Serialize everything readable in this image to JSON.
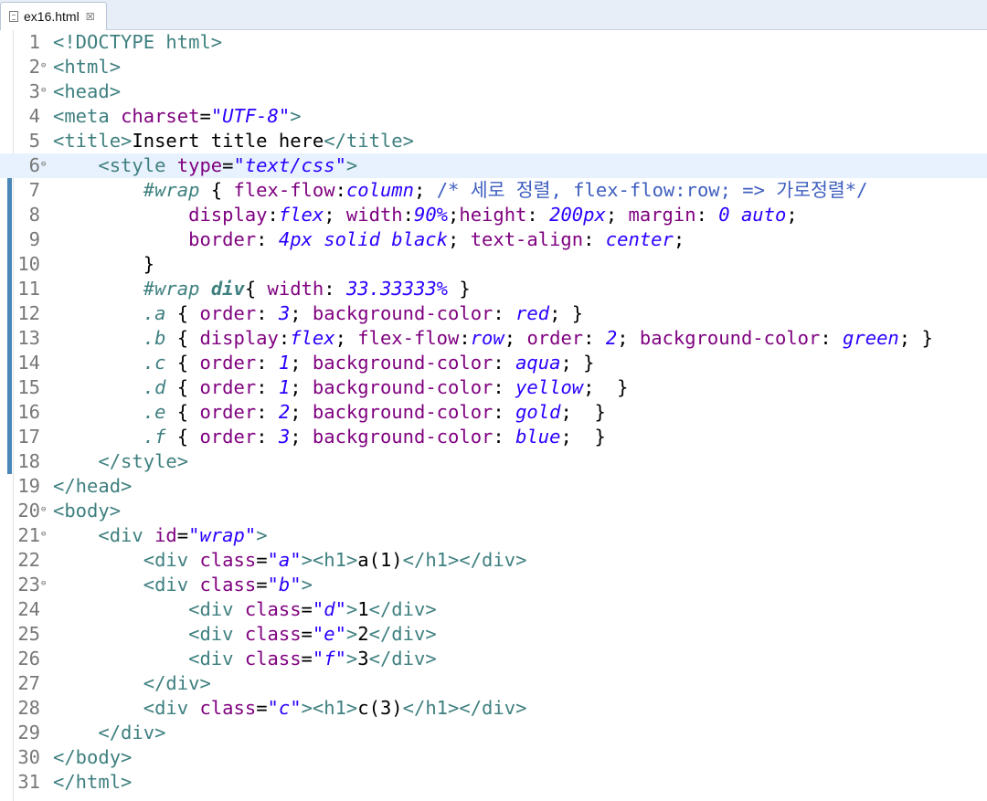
{
  "tab": {
    "title": "ex16.html",
    "close_glyph": "☒"
  },
  "colors": {
    "tag": "#3f7f7f",
    "attribute": "#7f007f",
    "value": "#2a00ff",
    "comment": "#3f5fbf",
    "current_line": "#e8f2fe",
    "change_bar": "#4a86b8"
  },
  "current_line": 6,
  "lines": [
    {
      "n": "1",
      "fold": false,
      "tokens": [
        {
          "t": "<!DOCTYPE html>",
          "c": "tag"
        }
      ]
    },
    {
      "n": "2",
      "fold": true,
      "tokens": [
        {
          "t": "<html>",
          "c": "tag"
        }
      ]
    },
    {
      "n": "3",
      "fold": true,
      "tokens": [
        {
          "t": "<head>",
          "c": "tag"
        }
      ]
    },
    {
      "n": "4",
      "fold": false,
      "tokens": [
        {
          "t": "<meta ",
          "c": "tag"
        },
        {
          "t": "charset",
          "c": "attr"
        },
        {
          "t": "=",
          "c": "pun"
        },
        {
          "t": "\"UTF-8\"",
          "c": "val"
        },
        {
          "t": ">",
          "c": "tag"
        }
      ]
    },
    {
      "n": "5",
      "fold": false,
      "tokens": [
        {
          "t": "<title>",
          "c": "tag"
        },
        {
          "t": "Insert title here",
          "c": "txt"
        },
        {
          "t": "</title>",
          "c": "tag"
        }
      ]
    },
    {
      "n": "6",
      "fold": true,
      "tokens": [
        {
          "t": "    ",
          "c": "txt"
        },
        {
          "t": "<style ",
          "c": "tag"
        },
        {
          "t": "type",
          "c": "attr"
        },
        {
          "t": "=",
          "c": "pun"
        },
        {
          "t": "\"text/css\"",
          "c": "val"
        },
        {
          "t": ">",
          "c": "tag"
        }
      ]
    },
    {
      "n": "7",
      "fold": false,
      "tokens": [
        {
          "t": "        ",
          "c": "txt"
        },
        {
          "t": "#wrap",
          "c": "sel"
        },
        {
          "t": " { ",
          "c": "pun"
        },
        {
          "t": "flex-flow",
          "c": "prop"
        },
        {
          "t": ":",
          "c": "pun"
        },
        {
          "t": "column",
          "c": "cval"
        },
        {
          "t": "; ",
          "c": "pun"
        },
        {
          "t": "/* 세로 정렬, flex-flow:row; => 가로정렬*/",
          "c": "cmt"
        }
      ]
    },
    {
      "n": "8",
      "fold": false,
      "tokens": [
        {
          "t": "            ",
          "c": "txt"
        },
        {
          "t": "display",
          "c": "prop"
        },
        {
          "t": ":",
          "c": "pun"
        },
        {
          "t": "flex",
          "c": "cval"
        },
        {
          "t": "; ",
          "c": "pun"
        },
        {
          "t": "width",
          "c": "prop"
        },
        {
          "t": ":",
          "c": "pun"
        },
        {
          "t": "90%",
          "c": "cval"
        },
        {
          "t": ";",
          "c": "pun"
        },
        {
          "t": "height",
          "c": "prop"
        },
        {
          "t": ": ",
          "c": "pun"
        },
        {
          "t": "200px",
          "c": "cval"
        },
        {
          "t": "; ",
          "c": "pun"
        },
        {
          "t": "margin",
          "c": "prop"
        },
        {
          "t": ": ",
          "c": "pun"
        },
        {
          "t": "0 auto",
          "c": "cval"
        },
        {
          "t": ";",
          "c": "pun"
        }
      ]
    },
    {
      "n": "9",
      "fold": false,
      "tokens": [
        {
          "t": "            ",
          "c": "txt"
        },
        {
          "t": "border",
          "c": "prop"
        },
        {
          "t": ": ",
          "c": "pun"
        },
        {
          "t": "4px solid black",
          "c": "cval"
        },
        {
          "t": "; ",
          "c": "pun"
        },
        {
          "t": "text-align",
          "c": "prop"
        },
        {
          "t": ": ",
          "c": "pun"
        },
        {
          "t": "center",
          "c": "cval"
        },
        {
          "t": ";",
          "c": "pun"
        }
      ]
    },
    {
      "n": "10",
      "fold": false,
      "tokens": [
        {
          "t": "        }",
          "c": "pun"
        }
      ]
    },
    {
      "n": "11",
      "fold": false,
      "tokens": [
        {
          "t": "        ",
          "c": "txt"
        },
        {
          "t": "#wrap ",
          "c": "sel"
        },
        {
          "t": "div",
          "c": "sel bold"
        },
        {
          "t": "{ ",
          "c": "pun"
        },
        {
          "t": "width",
          "c": "prop"
        },
        {
          "t": ": ",
          "c": "pun"
        },
        {
          "t": "33.33333%",
          "c": "cval"
        },
        {
          "t": " }",
          "c": "pun"
        }
      ]
    },
    {
      "n": "12",
      "fold": false,
      "tokens": [
        {
          "t": "        ",
          "c": "txt"
        },
        {
          "t": ".a",
          "c": "sel"
        },
        {
          "t": " { ",
          "c": "pun"
        },
        {
          "t": "order",
          "c": "prop"
        },
        {
          "t": ": ",
          "c": "pun"
        },
        {
          "t": "3",
          "c": "cval"
        },
        {
          "t": "; ",
          "c": "pun"
        },
        {
          "t": "background-color",
          "c": "prop"
        },
        {
          "t": ": ",
          "c": "pun"
        },
        {
          "t": "red",
          "c": "cval"
        },
        {
          "t": "; }",
          "c": "pun"
        }
      ]
    },
    {
      "n": "13",
      "fold": false,
      "tokens": [
        {
          "t": "        ",
          "c": "txt"
        },
        {
          "t": ".b",
          "c": "sel"
        },
        {
          "t": " { ",
          "c": "pun"
        },
        {
          "t": "display",
          "c": "prop"
        },
        {
          "t": ":",
          "c": "pun"
        },
        {
          "t": "flex",
          "c": "cval"
        },
        {
          "t": "; ",
          "c": "pun"
        },
        {
          "t": "flex-flow",
          "c": "prop"
        },
        {
          "t": ":",
          "c": "pun"
        },
        {
          "t": "row",
          "c": "cval"
        },
        {
          "t": "; ",
          "c": "pun"
        },
        {
          "t": "order",
          "c": "prop"
        },
        {
          "t": ": ",
          "c": "pun"
        },
        {
          "t": "2",
          "c": "cval"
        },
        {
          "t": "; ",
          "c": "pun"
        },
        {
          "t": "background-color",
          "c": "prop"
        },
        {
          "t": ": ",
          "c": "pun"
        },
        {
          "t": "green",
          "c": "cval"
        },
        {
          "t": "; }",
          "c": "pun"
        }
      ]
    },
    {
      "n": "14",
      "fold": false,
      "tokens": [
        {
          "t": "        ",
          "c": "txt"
        },
        {
          "t": ".c",
          "c": "sel"
        },
        {
          "t": " { ",
          "c": "pun"
        },
        {
          "t": "order",
          "c": "prop"
        },
        {
          "t": ": ",
          "c": "pun"
        },
        {
          "t": "1",
          "c": "cval"
        },
        {
          "t": "; ",
          "c": "pun"
        },
        {
          "t": "background-color",
          "c": "prop"
        },
        {
          "t": ": ",
          "c": "pun"
        },
        {
          "t": "aqua",
          "c": "cval"
        },
        {
          "t": "; }",
          "c": "pun"
        }
      ]
    },
    {
      "n": "15",
      "fold": false,
      "tokens": [
        {
          "t": "        ",
          "c": "txt"
        },
        {
          "t": ".d",
          "c": "sel"
        },
        {
          "t": " { ",
          "c": "pun"
        },
        {
          "t": "order",
          "c": "prop"
        },
        {
          "t": ": ",
          "c": "pun"
        },
        {
          "t": "1",
          "c": "cval"
        },
        {
          "t": "; ",
          "c": "pun"
        },
        {
          "t": "background-color",
          "c": "prop"
        },
        {
          "t": ": ",
          "c": "pun"
        },
        {
          "t": "yellow",
          "c": "cval"
        },
        {
          "t": ";  }",
          "c": "pun"
        }
      ]
    },
    {
      "n": "16",
      "fold": false,
      "tokens": [
        {
          "t": "        ",
          "c": "txt"
        },
        {
          "t": ".e",
          "c": "sel"
        },
        {
          "t": " { ",
          "c": "pun"
        },
        {
          "t": "order",
          "c": "prop"
        },
        {
          "t": ": ",
          "c": "pun"
        },
        {
          "t": "2",
          "c": "cval"
        },
        {
          "t": "; ",
          "c": "pun"
        },
        {
          "t": "background-color",
          "c": "prop"
        },
        {
          "t": ": ",
          "c": "pun"
        },
        {
          "t": "gold",
          "c": "cval"
        },
        {
          "t": ";  }",
          "c": "pun"
        }
      ]
    },
    {
      "n": "17",
      "fold": false,
      "tokens": [
        {
          "t": "        ",
          "c": "txt"
        },
        {
          "t": ".f",
          "c": "sel"
        },
        {
          "t": " { ",
          "c": "pun"
        },
        {
          "t": "order",
          "c": "prop"
        },
        {
          "t": ": ",
          "c": "pun"
        },
        {
          "t": "3",
          "c": "cval"
        },
        {
          "t": "; ",
          "c": "pun"
        },
        {
          "t": "background-color",
          "c": "prop"
        },
        {
          "t": ": ",
          "c": "pun"
        },
        {
          "t": "blue",
          "c": "cval"
        },
        {
          "t": ";  }",
          "c": "pun"
        }
      ]
    },
    {
      "n": "18",
      "fold": false,
      "tokens": [
        {
          "t": "    ",
          "c": "txt"
        },
        {
          "t": "</style>",
          "c": "tag"
        }
      ]
    },
    {
      "n": "19",
      "fold": false,
      "tokens": [
        {
          "t": "</head>",
          "c": "tag"
        }
      ]
    },
    {
      "n": "20",
      "fold": true,
      "tokens": [
        {
          "t": "<body>",
          "c": "tag"
        }
      ]
    },
    {
      "n": "21",
      "fold": true,
      "tokens": [
        {
          "t": "    ",
          "c": "txt"
        },
        {
          "t": "<div ",
          "c": "tag"
        },
        {
          "t": "id",
          "c": "attr"
        },
        {
          "t": "=",
          "c": "pun"
        },
        {
          "t": "\"wrap\"",
          "c": "val"
        },
        {
          "t": ">",
          "c": "tag"
        }
      ]
    },
    {
      "n": "22",
      "fold": false,
      "tokens": [
        {
          "t": "        ",
          "c": "txt"
        },
        {
          "t": "<div ",
          "c": "tag"
        },
        {
          "t": "class",
          "c": "attr"
        },
        {
          "t": "=",
          "c": "pun"
        },
        {
          "t": "\"a\"",
          "c": "val"
        },
        {
          "t": "><h1>",
          "c": "tag"
        },
        {
          "t": "a(1)",
          "c": "txt"
        },
        {
          "t": "</h1></div>",
          "c": "tag"
        }
      ]
    },
    {
      "n": "23",
      "fold": true,
      "tokens": [
        {
          "t": "        ",
          "c": "txt"
        },
        {
          "t": "<div ",
          "c": "tag"
        },
        {
          "t": "class",
          "c": "attr"
        },
        {
          "t": "=",
          "c": "pun"
        },
        {
          "t": "\"b\"",
          "c": "val"
        },
        {
          "t": ">",
          "c": "tag"
        }
      ]
    },
    {
      "n": "24",
      "fold": false,
      "tokens": [
        {
          "t": "            ",
          "c": "txt"
        },
        {
          "t": "<div ",
          "c": "tag"
        },
        {
          "t": "class",
          "c": "attr"
        },
        {
          "t": "=",
          "c": "pun"
        },
        {
          "t": "\"d\"",
          "c": "val"
        },
        {
          "t": ">",
          "c": "tag"
        },
        {
          "t": "1",
          "c": "txt"
        },
        {
          "t": "</div>",
          "c": "tag"
        }
      ]
    },
    {
      "n": "25",
      "fold": false,
      "tokens": [
        {
          "t": "            ",
          "c": "txt"
        },
        {
          "t": "<div ",
          "c": "tag"
        },
        {
          "t": "class",
          "c": "attr"
        },
        {
          "t": "=",
          "c": "pun"
        },
        {
          "t": "\"e\"",
          "c": "val"
        },
        {
          "t": ">",
          "c": "tag"
        },
        {
          "t": "2",
          "c": "txt"
        },
        {
          "t": "</div>",
          "c": "tag"
        }
      ]
    },
    {
      "n": "26",
      "fold": false,
      "tokens": [
        {
          "t": "            ",
          "c": "txt"
        },
        {
          "t": "<div ",
          "c": "tag"
        },
        {
          "t": "class",
          "c": "attr"
        },
        {
          "t": "=",
          "c": "pun"
        },
        {
          "t": "\"f\"",
          "c": "val"
        },
        {
          "t": ">",
          "c": "tag"
        },
        {
          "t": "3",
          "c": "txt"
        },
        {
          "t": "</div>",
          "c": "tag"
        }
      ]
    },
    {
      "n": "27",
      "fold": false,
      "tokens": [
        {
          "t": "        ",
          "c": "txt"
        },
        {
          "t": "</div>",
          "c": "tag"
        }
      ]
    },
    {
      "n": "28",
      "fold": false,
      "tokens": [
        {
          "t": "        ",
          "c": "txt"
        },
        {
          "t": "<div ",
          "c": "tag"
        },
        {
          "t": "class",
          "c": "attr"
        },
        {
          "t": "=",
          "c": "pun"
        },
        {
          "t": "\"c\"",
          "c": "val"
        },
        {
          "t": "><h1>",
          "c": "tag"
        },
        {
          "t": "c(3)",
          "c": "txt"
        },
        {
          "t": "</h1></div>",
          "c": "tag"
        }
      ]
    },
    {
      "n": "29",
      "fold": false,
      "tokens": [
        {
          "t": "    ",
          "c": "txt"
        },
        {
          "t": "</div>",
          "c": "tag"
        }
      ]
    },
    {
      "n": "30",
      "fold": false,
      "tokens": [
        {
          "t": "</body>",
          "c": "tag"
        }
      ]
    },
    {
      "n": "31",
      "fold": false,
      "tokens": [
        {
          "t": "</html>",
          "c": "tag"
        }
      ]
    }
  ]
}
